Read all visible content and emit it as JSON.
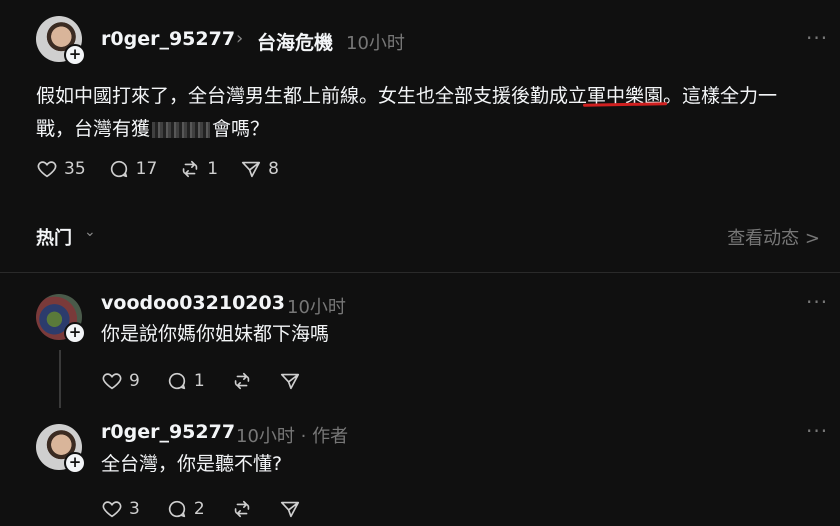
{
  "post": {
    "username": "r0ger_95277",
    "community": "台海危機",
    "time": "10小时",
    "text_part1": "假如中國打來了，全台灣男生都上前線。女生也全部支援後勤成立",
    "text_underlined": "軍中樂園",
    "text_part2": "。這樣全力一",
    "text_line2_a": "戰，台灣有獲",
    "text_line2_b": "會嗎？",
    "likes": "35",
    "comments": "17",
    "reposts": "1",
    "shares": "8"
  },
  "sort": {
    "label": "热门",
    "view_activity": "查看动态 >"
  },
  "replies": [
    {
      "username": "voodoo03210203",
      "time": "10小时",
      "text": "你是說你媽你姐妹都下海嗎",
      "likes": "9",
      "comments": "1"
    },
    {
      "username": "r0ger_95277",
      "time": "10小时 · 作者",
      "text": "全台灣，你是聽不懂?",
      "likes": "3",
      "comments": "2"
    }
  ],
  "icons": [
    "heart-icon",
    "comment-icon",
    "repost-icon",
    "share-icon",
    "more-icon",
    "chevron-right-icon",
    "chevron-down-icon",
    "plus-icon"
  ]
}
